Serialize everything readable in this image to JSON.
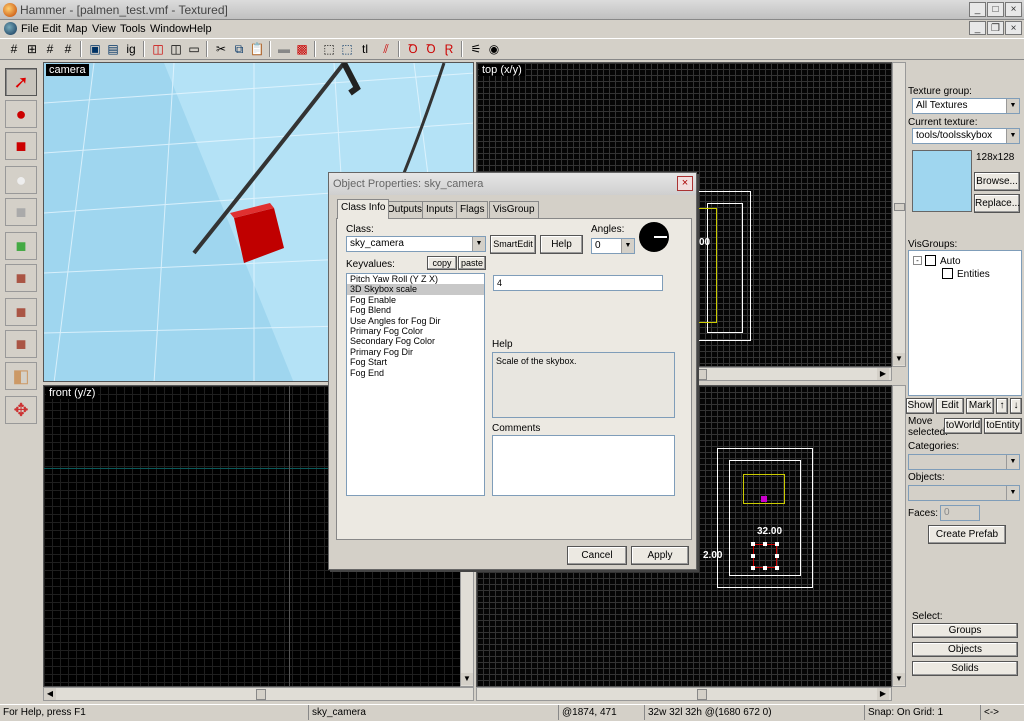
{
  "window": {
    "title": "Hammer - [palmen_test.vmf - Textured]"
  },
  "menu": [
    "File",
    "Edit",
    "Map",
    "View",
    "Tools",
    "Window",
    "Help"
  ],
  "toolbar": {
    "icons": [
      "grid-toggle",
      "grid-3d",
      "grid-dots",
      "grid-hash",
      "group",
      "ungroup",
      "carve",
      "hide",
      "show",
      "cut",
      "copy",
      "paste",
      "texture",
      "tie",
      "select",
      "scale",
      "quick",
      "flip",
      "load",
      "save",
      "run",
      "ignore",
      "decals"
    ]
  },
  "viewports": {
    "camera": {
      "label": "camera"
    },
    "top": {
      "label": "top (x/y)",
      "size_label": "00"
    },
    "front": {
      "label": "front (y/z)"
    },
    "side": {
      "dim_label_w": "32.00",
      "dim_label_h": "2.00"
    }
  },
  "right_panel": {
    "texture_group_label": "Texture group:",
    "texture_group_value": "All Textures",
    "current_texture_label": "Current texture:",
    "current_texture_value": "tools/toolsskybox",
    "texture_size": "128x128",
    "browse": "Browse...",
    "replace": "Replace...",
    "visgroups_label": "VisGroups:",
    "visgroups_tree": [
      {
        "name": "Auto"
      },
      {
        "name": "Entities"
      }
    ],
    "show": "Show",
    "edit": "Edit",
    "mark": "Mark",
    "move_selected": "Move selected:",
    "to_world": "toWorld",
    "to_entity": "toEntity",
    "categories_label": "Categories:",
    "objects_label": "Objects:",
    "faces_label": "Faces:",
    "faces_value": "0",
    "create_prefab": "Create Prefab",
    "select_label": "Select:",
    "groups": "Groups",
    "objects": "Objects",
    "solids": "Solids"
  },
  "dialog": {
    "title": "Object Properties: sky_camera",
    "tabs": [
      "Class Info",
      "Outputs",
      "Inputs",
      "Flags",
      "VisGroup"
    ],
    "class_label": "Class:",
    "class_value": "sky_camera",
    "smartedit": "SmartEdit",
    "help": "Help",
    "angles_label": "Angles:",
    "angles_value": "0",
    "keyvalues_label": "Keyvalues:",
    "copy": "copy",
    "paste": "paste",
    "keyvalues": [
      "Pitch Yaw Roll (Y Z X)",
      "3D Skybox scale",
      "Fog Enable",
      "Fog Blend",
      "Use Angles for Fog Dir",
      "Primary Fog Color",
      "Secondary Fog Color",
      "Primary Fog Dir",
      "Fog Start",
      "Fog End"
    ],
    "selected_index": 1,
    "value": "4",
    "help_label": "Help",
    "help_text": "Scale of the skybox.",
    "comments_label": "Comments",
    "cancel": "Cancel",
    "apply": "Apply"
  },
  "status": {
    "help": "For Help, press F1",
    "selection": "sky_camera",
    "coords": "@1874, 471",
    "size": "32w 32l 32h @(1680 672 0)",
    "snap": "Snap: On Grid: 1",
    "nav": "<->"
  },
  "colors": {
    "selection": "#cc0000",
    "accent": "#ffff00"
  }
}
